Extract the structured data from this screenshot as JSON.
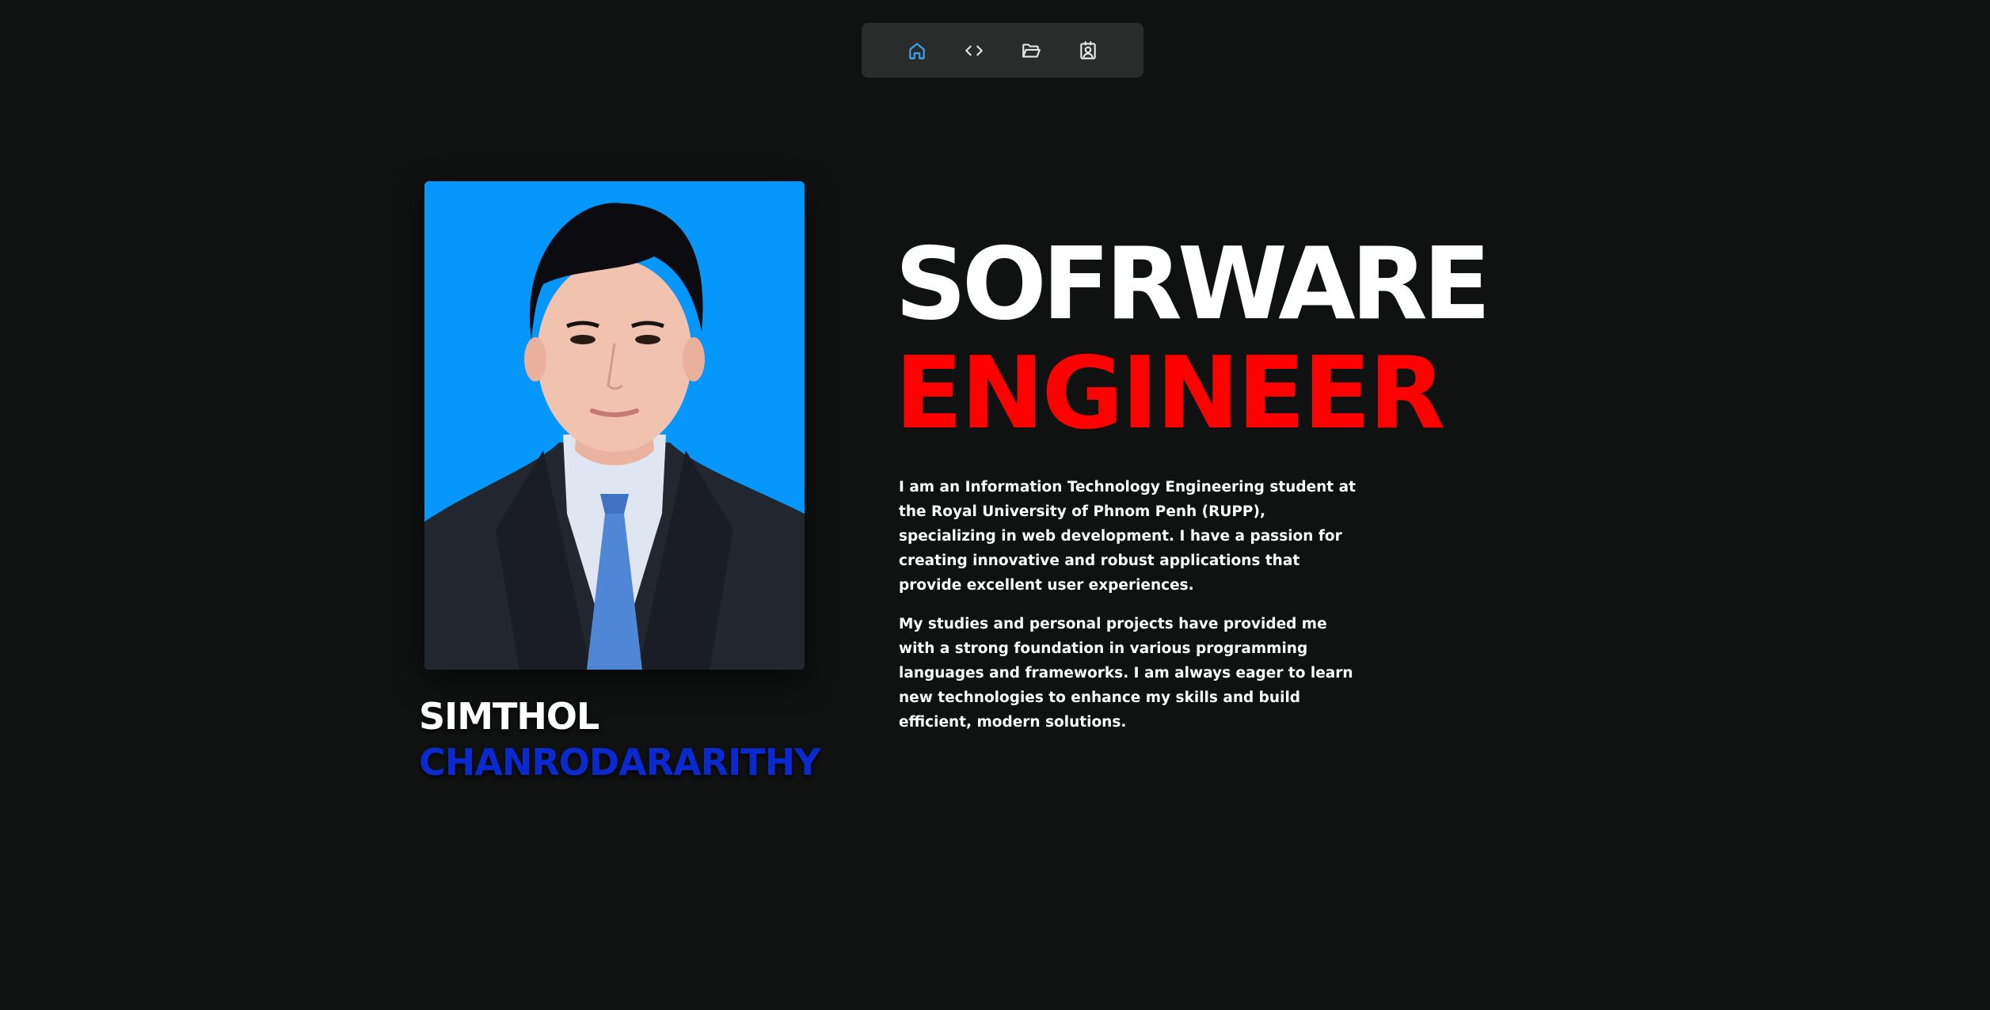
{
  "nav": {
    "items": [
      {
        "icon": "home-icon",
        "active": true
      },
      {
        "icon": "code-icon",
        "active": false
      },
      {
        "icon": "folder-open-icon",
        "active": false
      },
      {
        "icon": "contact-icon",
        "active": false
      }
    ],
    "active_color": "#3aa7e8",
    "inactive_color": "#e6e6e6"
  },
  "profile": {
    "first_name": "SIMTHOL",
    "last_name": "CHANRODARARITHY",
    "photo_background": "#0597fb"
  },
  "headline": {
    "line1": "SOFRWARE",
    "line2": "ENGINEER",
    "line1_color": "#ffffff",
    "line2_color": "#ff0000"
  },
  "about": {
    "paragraph1": "I am an Information Technology Engineering student at the Royal University of Phnom Penh (RUPP), specializing in web development. I have a passion for creating innovative and robust applications that provide excellent user experiences.",
    "paragraph2": "My studies and personal projects have provided me with a strong foundation in various programming languages and frameworks. I am always eager to learn new technologies to enhance my skills and build efficient, modern solutions."
  }
}
